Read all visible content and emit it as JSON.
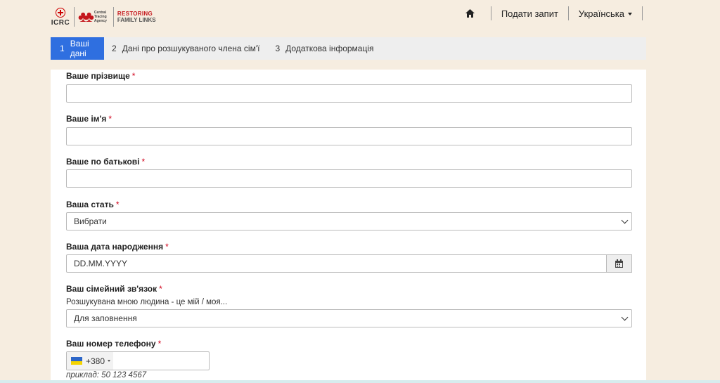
{
  "header": {
    "logos": {
      "icrc": "ICRC",
      "cta": "Central Tracing Agency",
      "rfl_line1": "RESTORING",
      "rfl_line2": "FAMILY LINKS"
    },
    "nav": {
      "home_icon": "home-icon",
      "submit_request": "Подати запит",
      "language": "Українська"
    }
  },
  "steps": [
    {
      "num": "1",
      "label": "Ваші дані",
      "active": true
    },
    {
      "num": "2",
      "label": "Дані про розшукуваного члена сім'ї",
      "active": false
    },
    {
      "num": "3",
      "label": "Додаткова інформація",
      "active": false
    }
  ],
  "form": {
    "required_mark": "*",
    "surname": {
      "label": "Ваше прізвище",
      "value": ""
    },
    "first_name": {
      "label": "Ваше ім'я",
      "value": ""
    },
    "patronymic": {
      "label": "Ваше по батькові",
      "value": ""
    },
    "gender": {
      "label": "Ваша стать",
      "selected": "Вибрати"
    },
    "birth_date": {
      "label": "Ваша дата народження",
      "placeholder": "DD.MM.YYYY",
      "icon": "calendar-icon"
    },
    "relation": {
      "label": "Ваш сімейний зв'язок",
      "help": "Розшукувана мною людина - це мій / моя...",
      "selected": "Для заповнення"
    },
    "phone": {
      "label": "Ваш номер телефону",
      "flag": "ukraine-flag-icon",
      "dial_code": "+380",
      "example": "приклад: 50 123 4567"
    }
  },
  "colors": {
    "background": "#f6ede0",
    "accent": "#2f6fe0",
    "required": "#d0021b",
    "brand_red": "#c4161c"
  }
}
